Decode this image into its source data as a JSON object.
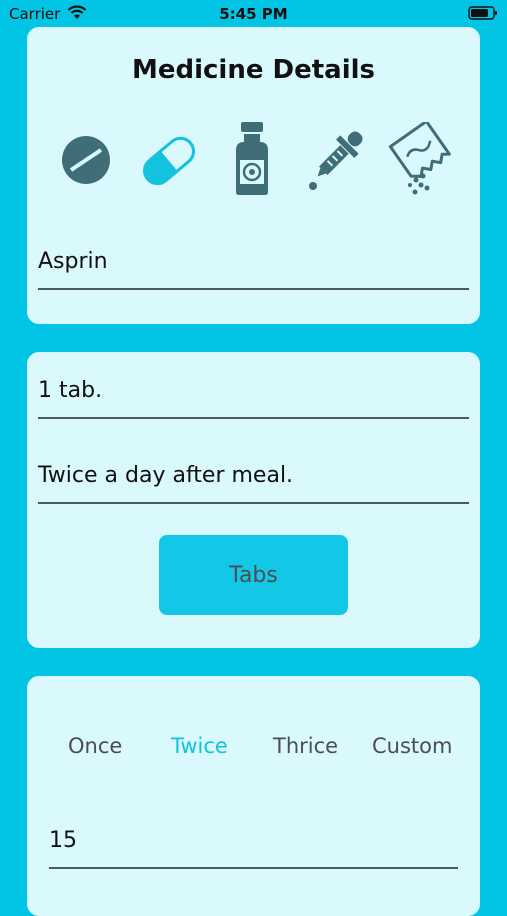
{
  "status_bar": {
    "carrier": "Carrier",
    "time": "5:45 PM"
  },
  "medicine_card": {
    "title": "Medicine Details",
    "icons": [
      "tablet-icon",
      "capsule-icon",
      "bottle-icon",
      "dropper-icon",
      "powder-sachet-icon"
    ],
    "selected_icon": "capsule-icon",
    "name_value": "Asprin"
  },
  "dosage_card": {
    "dose_value": "1 tab.",
    "instructions_value": "Twice a day after meal.",
    "unit_button_label": "Tabs"
  },
  "frequency_card": {
    "options": [
      "Once",
      "Twice",
      "Thrice",
      "Custom"
    ],
    "selected_option": "Twice",
    "amount_value": "15"
  },
  "colors": {
    "background": "#02c4e4",
    "card": "#daf9fd",
    "accent": "#12c2df",
    "icon": "#3f6e78"
  }
}
